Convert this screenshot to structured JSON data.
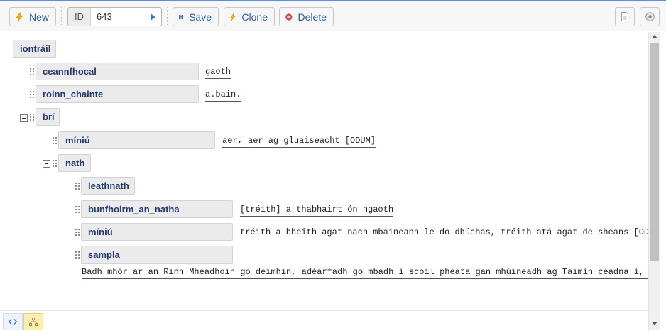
{
  "toolbar": {
    "new_label": "New",
    "id_label": "ID",
    "id_value": "643",
    "save_label": "Save",
    "clone_label": "Clone",
    "delete_label": "Delete"
  },
  "icons": {
    "new": "lightning-icon",
    "save": "floppy-disk-icon",
    "clone": "lightning-icon",
    "delete": "delete-circle-icon",
    "document": "document-icon",
    "settings": "circle-settings-icon",
    "source_view": "code-icon",
    "tree_view": "tree-icon"
  },
  "colors": {
    "accent_blue": "#2f5ea8",
    "node_text": "#223a70",
    "delete_red": "#d9534f",
    "lightning_yellow": "#f2b200",
    "tree_toggle_active": "#fbeeb0"
  },
  "tree": {
    "root": "iontráil",
    "ceannfhocal": {
      "label": "ceannfhocal",
      "value": "gaoth"
    },
    "roinn_chainte": {
      "label": "roinn_chainte",
      "value": "a.bain."
    },
    "bri": {
      "label": "brí"
    },
    "bri_miniu": {
      "label": "míniú",
      "value": "aer, aer ag gluaiseacht [ODUM]"
    },
    "nath": {
      "label": "nath"
    },
    "leathnath": {
      "label": "leathnath"
    },
    "bunfhoirm": {
      "label": "bunfhoirm_an_natha",
      "value": "[tréith] a thabhairt ón ngaoth"
    },
    "nath_miniu": {
      "label": "míniú",
      "value": "tréith a bheith agat nach mbaineann le do dhúchas, tréith atá agat de sheans [OD, HJ]"
    },
    "sampla": {
      "label": "sampla",
      "value": "Badh mhór ar an Rinn Mheadhoin go deimhin, adéarfadh go mbadh í scoil pheata gan mhúineadh ag Taimín céadna í, agus nach mh"
    }
  }
}
